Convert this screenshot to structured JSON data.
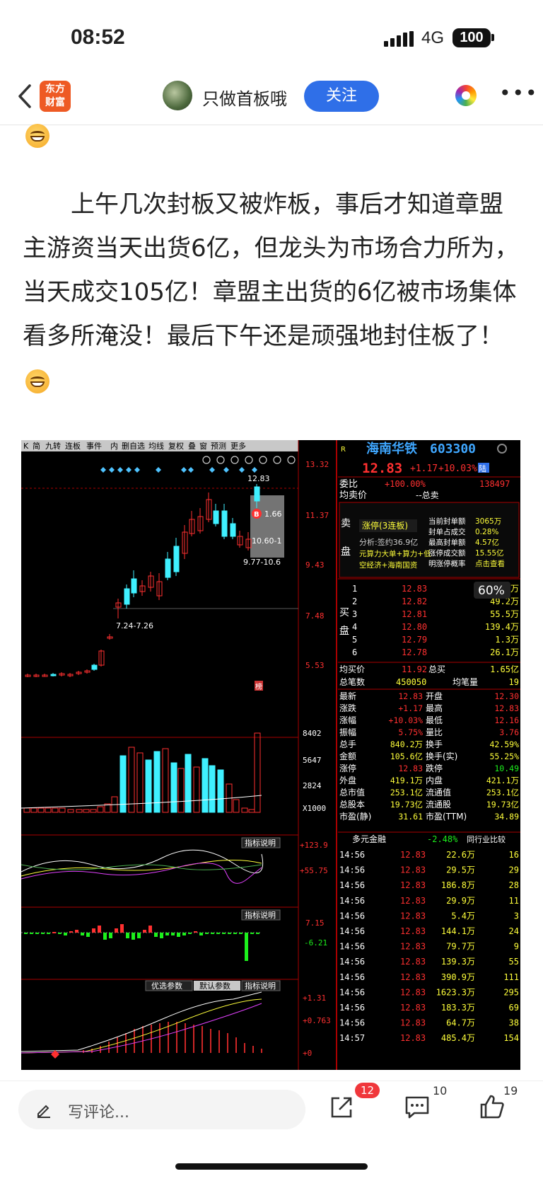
{
  "status": {
    "time": "08:52",
    "network": "4G",
    "battery": "100"
  },
  "nav": {
    "logo_line1": "东方",
    "logo_line2": "财富",
    "author": "只做首板哦",
    "follow_label": "关注"
  },
  "article": {
    "paragraph": "上午几次封板又被炸板，事后才知道章盟主游资当天出货6亿，但龙头为市场合力所为，当天成交105亿！章盟主出货的6亿被市场集体看多所淹没！最后下午还是顽强地封住板了！"
  },
  "screenshot": {
    "toolbar": [
      "K",
      "简",
      "九转",
      "连板",
      "事件",
      "内",
      "删自选",
      "均线",
      "复权",
      "叠",
      "窗",
      "预测",
      "更多"
    ],
    "stock_name": "海南华铁",
    "stock_code": "603300",
    "last_price": "12.83",
    "change": "+1.17",
    "change_pct": "+10.03%",
    "hsgt_tag": "陆",
    "price_axis": [
      "13.32",
      "11.37",
      "9.43",
      "7.48",
      "5.53"
    ],
    "price_high_label": "12.83",
    "box_labels": [
      "1.66",
      "10.60-1",
      "9.77-10.6"
    ],
    "low_range_label": "7.24-7.26",
    "volume_axis": [
      "8402",
      "5647",
      "2824",
      "X1000"
    ],
    "indicator_button": "指标说明",
    "ind1_axis": [
      "+123.9",
      "+55.75"
    ],
    "ind2_axis": [
      "7.15",
      "-6.21"
    ],
    "ind3_tabs": [
      "优选参数",
      "默认参数"
    ],
    "ind3_axis": [
      "+1.31",
      "+0.763",
      "+0"
    ],
    "b_marker": "B",
    "bang_marker": "榜",
    "weibi": {
      "label": "委比",
      "pct": "+100.00%",
      "value": "138497"
    },
    "junmai": {
      "label": "均卖价",
      "value": "--总卖"
    },
    "sell_label": [
      "卖",
      "盘"
    ],
    "limit_up_info": {
      "title": "涨停(3连板)",
      "analysis": "分析:签约36.9亿",
      "tags": "元算力大单+算力+低空经济+海南国资",
      "rows": [
        [
          "当前封单额",
          "3065万"
        ],
        [
          "封单占成交",
          "0.28%"
        ],
        [
          "最高封单额",
          "4.57亿"
        ],
        [
          "涨停成交额",
          "15.55亿"
        ],
        [
          "明涨停概率",
          "点击查看"
        ]
      ]
    },
    "buy_label": [
      "买",
      "盘"
    ],
    "buy_orders": [
      [
        "1",
        "12.83",
        "30.6万"
      ],
      [
        "2",
        "12.82",
        "49.2万"
      ],
      [
        "3",
        "12.81",
        "55.5万"
      ],
      [
        "4",
        "12.80",
        "139.4万"
      ],
      [
        "5",
        "12.79",
        "1.3万"
      ],
      [
        "6",
        "12.78",
        "26.1万"
      ]
    ],
    "zoom_badge": "60%",
    "junmai_buy": {
      "label": "均买价",
      "value": "11.92",
      "label2": "总买",
      "value2": "1.65亿"
    },
    "bishu": {
      "label": "总笔数",
      "value": "450050",
      "label2": "均笔量",
      "value2": "19"
    },
    "stats": [
      [
        "最新",
        "12.83",
        "开盘",
        "12.30"
      ],
      [
        "涨跌",
        "+1.17",
        "最高",
        "12.83"
      ],
      [
        "涨幅",
        "+10.03%",
        "最低",
        "12.16"
      ],
      [
        "振幅",
        "5.75%",
        "量比",
        "3.76"
      ],
      [
        "总手",
        "840.2万",
        "换手",
        "42.59%"
      ],
      [
        "金额",
        "105.6亿",
        "换手(实)",
        "55.25%"
      ],
      [
        "涨停",
        "12.83",
        "跌停",
        "10.49"
      ],
      [
        "外盘",
        "419.1万",
        "内盘",
        "421.1万"
      ],
      [
        "总市值",
        "253.1亿",
        "流通值",
        "253.1亿"
      ],
      [
        "总股本",
        "19.73亿",
        "流通股",
        "19.73亿"
      ],
      [
        "市盈(静)",
        "31.61",
        "市盈(TTM)",
        "34.89"
      ]
    ],
    "sector": {
      "name": "多元金融",
      "pct": "-2.48%",
      "compare": "同行业比较"
    },
    "ticks": [
      [
        "14:56",
        "12.83",
        "22.6万",
        "16"
      ],
      [
        "14:56",
        "12.83",
        "29.5万",
        "29"
      ],
      [
        "14:56",
        "12.83",
        "186.8万",
        "28"
      ],
      [
        "14:56",
        "12.83",
        "29.9万",
        "11"
      ],
      [
        "14:56",
        "12.83",
        "5.4万",
        "3"
      ],
      [
        "14:56",
        "12.83",
        "144.1万",
        "24"
      ],
      [
        "14:56",
        "12.83",
        "79.7万",
        "9"
      ],
      [
        "14:56",
        "12.83",
        "139.3万",
        "55"
      ],
      [
        "14:56",
        "12.83",
        "390.9万",
        "111"
      ],
      [
        "14:56",
        "12.83",
        "1623.3万",
        "295"
      ],
      [
        "14:56",
        "12.83",
        "183.3万",
        "69"
      ],
      [
        "14:56",
        "12.83",
        "64.7万",
        "38"
      ],
      [
        "14:57",
        "12.83",
        "485.4万",
        "154"
      ]
    ]
  },
  "bottom": {
    "comment_placeholder": "写评论...",
    "share_badge": "12",
    "comment_count": "10",
    "like_count": "19"
  },
  "colors": {
    "accent_blue": "#2f6fe8",
    "badge_red": "#f0373b",
    "stock_red": "#ff3030",
    "stock_cyan": "#3ff0ff",
    "stock_yellow": "#ffff3a"
  }
}
